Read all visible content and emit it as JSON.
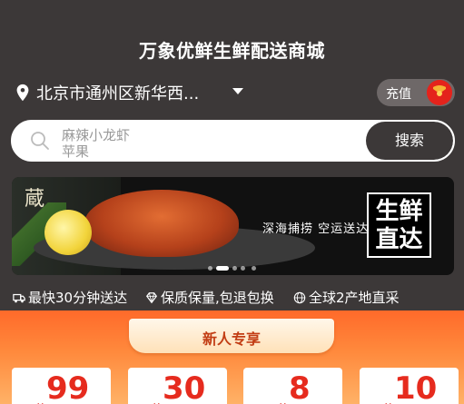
{
  "header": {
    "title": "万象优鲜生鲜配送商城"
  },
  "location": {
    "address": "北京市通州区新华西...",
    "icon": "location-pin-icon"
  },
  "recharge": {
    "label": "充值",
    "icon": "red-envelope-icon"
  },
  "search": {
    "hot_keywords": [
      "麻辣小龙虾",
      "苹果"
    ],
    "button_label": "搜索",
    "icon": "search-icon"
  },
  "banner": {
    "slogan": "深海捕捞 空运送达",
    "stamp_line1": "生鲜",
    "stamp_line2": "直达",
    "stamp_side_char": "蔵",
    "active_slide": 2,
    "total_slides": 5
  },
  "features": [
    {
      "icon": "delivery-truck-icon",
      "label": "最快30分钟送达"
    },
    {
      "icon": "diamond-icon",
      "label": "保质保量,包退包换"
    },
    {
      "icon": "globe-icon",
      "label": "全球2产地直采"
    }
  ],
  "promo": {
    "title": "新人专享",
    "currency": "¥",
    "coupons": [
      "99",
      "30",
      "8",
      "10"
    ]
  },
  "colors": {
    "dark_bg": "#3c3838",
    "accent_red": "#e62b1e",
    "promo_orange": "#ff6a2a"
  }
}
